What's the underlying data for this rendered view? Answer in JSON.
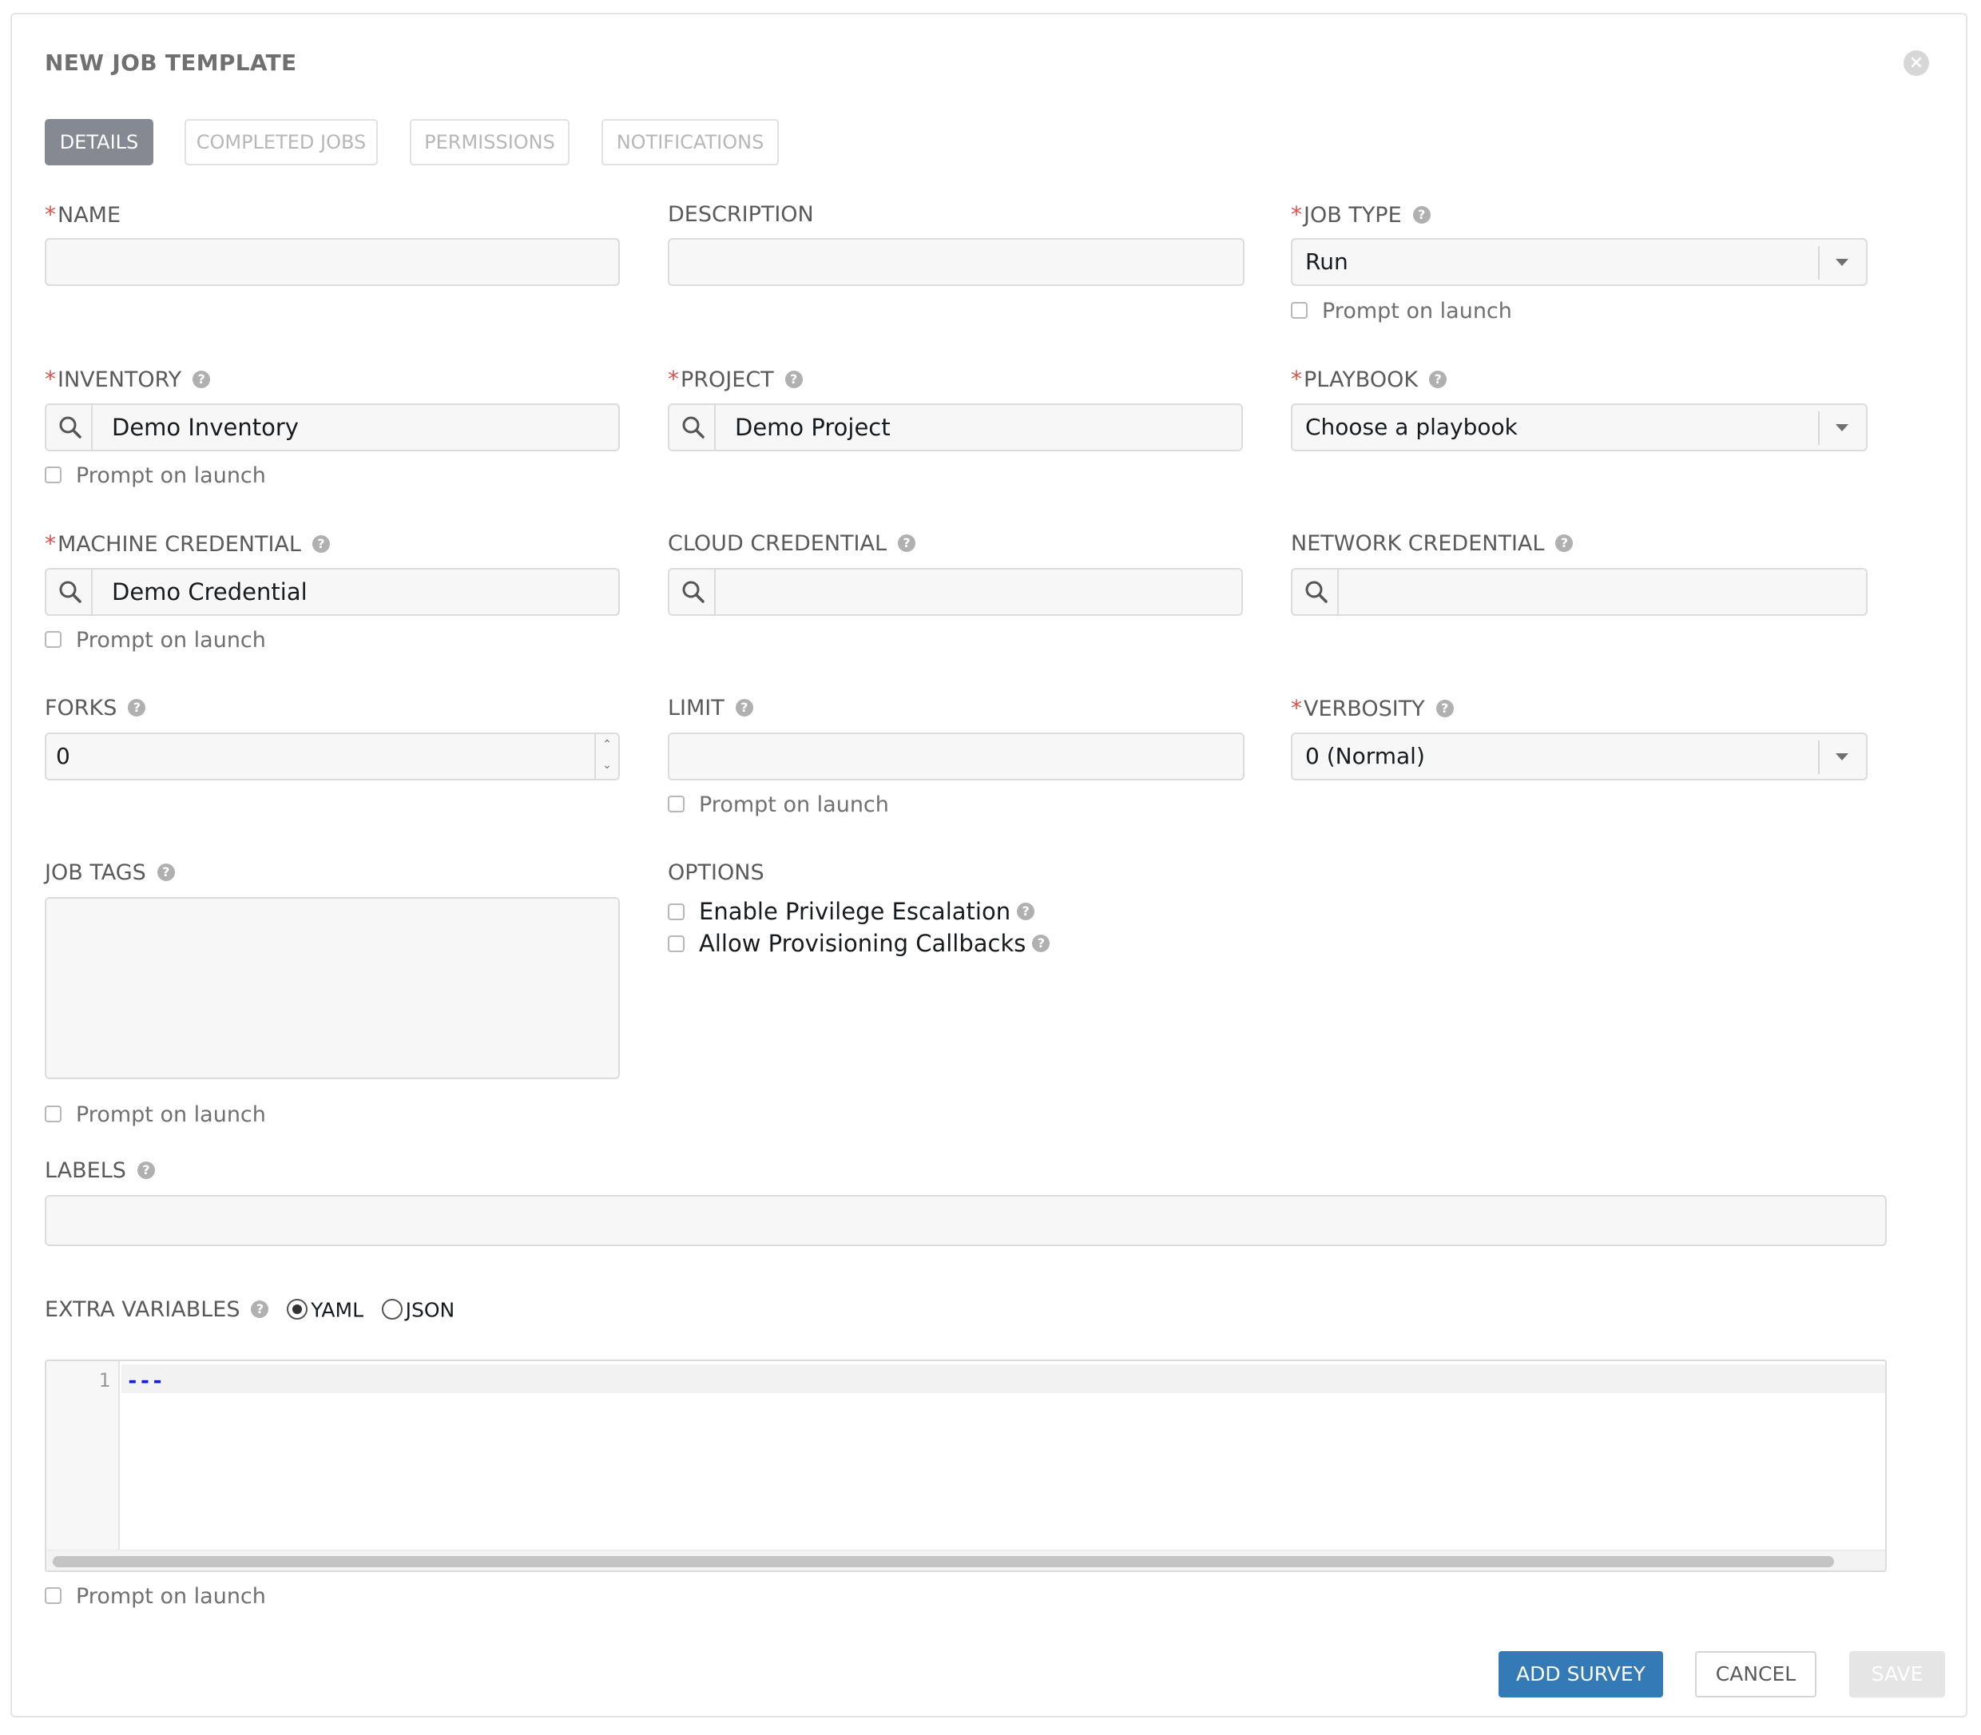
{
  "dialog": {
    "title": "NEW JOB TEMPLATE",
    "close_icon": "×"
  },
  "tabs": [
    {
      "label": "DETAILS",
      "active": true
    },
    {
      "label": "COMPLETED JOBS",
      "active": false
    },
    {
      "label": "PERMISSIONS",
      "active": false
    },
    {
      "label": "NOTIFICATIONS",
      "active": false
    }
  ],
  "required_marker": "*",
  "help_glyph": "?",
  "prompt_on_launch": "Prompt on launch",
  "fields": {
    "name": {
      "label": "NAME",
      "value": ""
    },
    "description": {
      "label": "DESCRIPTION",
      "value": ""
    },
    "job_type": {
      "label": "JOB TYPE",
      "value": "Run"
    },
    "inventory": {
      "label": "INVENTORY",
      "value": "Demo Inventory"
    },
    "project": {
      "label": "PROJECT",
      "value": "Demo Project"
    },
    "playbook": {
      "label": "PLAYBOOK",
      "value": "Choose a playbook"
    },
    "machine_credential": {
      "label": "MACHINE CREDENTIAL",
      "value": "Demo Credential"
    },
    "cloud_credential": {
      "label": "CLOUD CREDENTIAL",
      "value": ""
    },
    "network_credential": {
      "label": "NETWORK CREDENTIAL",
      "value": ""
    },
    "forks": {
      "label": "FORKS",
      "value": "0"
    },
    "limit": {
      "label": "LIMIT",
      "value": ""
    },
    "verbosity": {
      "label": "VERBOSITY",
      "value": "0 (Normal)"
    },
    "job_tags": {
      "label": "JOB TAGS",
      "value": ""
    },
    "options": {
      "label": "OPTIONS",
      "privilege_escalation": "Enable Privilege Escalation",
      "provisioning_callbacks": "Allow Provisioning Callbacks"
    },
    "labels": {
      "label": "LABELS",
      "value": ""
    },
    "extra_variables": {
      "label": "EXTRA VARIABLES",
      "format_yaml": "YAML",
      "format_json": "JSON",
      "selected_format": "YAML",
      "line_number": "1",
      "code": "---"
    }
  },
  "actions": {
    "add_survey": "ADD SURVEY",
    "cancel": "CANCEL",
    "save": "SAVE"
  },
  "colors": {
    "primary": "#337ab7",
    "required": "#d9534f",
    "active_tab": "#848992"
  }
}
